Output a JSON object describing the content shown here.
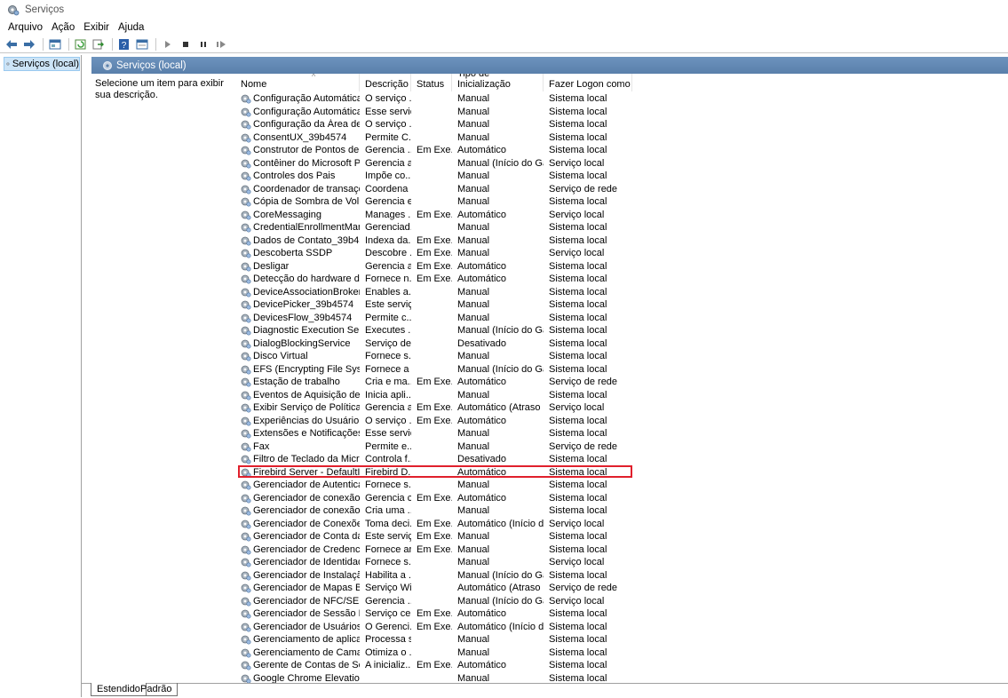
{
  "window": {
    "title": "Serviços"
  },
  "menu": [
    "Arquivo",
    "Ação",
    "Exibir",
    "Ajuda"
  ],
  "toolbar": {
    "icons": [
      "back-icon",
      "forward-icon",
      "console-tree-icon",
      "refresh-icon",
      "export-icon",
      "help-icon",
      "properties-icon",
      "play-icon",
      "stop-icon",
      "pause-icon",
      "resume-icon"
    ]
  },
  "tree": {
    "root_label": "Serviços (local)"
  },
  "header": {
    "label": "Serviços (local)"
  },
  "description": {
    "text": "Selecione um item para exibir sua descrição."
  },
  "columns": {
    "name": "Nome",
    "desc": "Descrição",
    "status": "Status",
    "start": "Tipo de Inicialização",
    "logon": "Fazer Logon como"
  },
  "services": [
    [
      "Configuração Automática d...",
      "O serviço ...",
      "",
      "Manual",
      "Sistema local"
    ],
    [
      "Configuração Automática d...",
      "Esse serviç...",
      "",
      "Manual",
      "Sistema local"
    ],
    [
      "Configuração da Área de Tr...",
      "O serviço ...",
      "",
      "Manual",
      "Sistema local"
    ],
    [
      "ConsentUX_39b4574",
      "Permite C...",
      "",
      "Manual",
      "Sistema local"
    ],
    [
      "Construtor de Pontos de Ex...",
      "Gerencia ...",
      "Em Exe...",
      "Automático",
      "Sistema local"
    ],
    [
      "Contêiner do Microsoft Pas...",
      "Gerencia a...",
      "",
      "Manual (Início do Ga...",
      "Serviço local"
    ],
    [
      "Controles dos Pais",
      "Impõe co...",
      "",
      "Manual",
      "Sistema local"
    ],
    [
      "Coordenador de transações...",
      "Coordena ...",
      "",
      "Manual",
      "Serviço de rede"
    ],
    [
      "Cópia de Sombra de Volume",
      "Gerencia e...",
      "",
      "Manual",
      "Sistema local"
    ],
    [
      "CoreMessaging",
      "Manages ...",
      "Em Exe...",
      "Automático",
      "Serviço local"
    ],
    [
      "CredentialEnrollmentMana...",
      "Gerenciad...",
      "",
      "Manual",
      "Sistema local"
    ],
    [
      "Dados de Contato_39b4574",
      "Indexa da...",
      "Em Exe...",
      "Manual",
      "Sistema local"
    ],
    [
      "Descoberta SSDP",
      "Descobre ...",
      "Em Exe...",
      "Manual",
      "Serviço local"
    ],
    [
      "Desligar",
      "Gerencia a...",
      "Em Exe...",
      "Automático",
      "Sistema local"
    ],
    [
      "Detecção do hardware do s...",
      "Fornece n...",
      "Em Exe...",
      "Automático",
      "Sistema local"
    ],
    [
      "DeviceAssociationBroker_39...",
      "Enables a...",
      "",
      "Manual",
      "Sistema local"
    ],
    [
      "DevicePicker_39b4574",
      "Este serviç...",
      "",
      "Manual",
      "Sistema local"
    ],
    [
      "DevicesFlow_39b4574",
      "Permite c...",
      "",
      "Manual",
      "Sistema local"
    ],
    [
      "Diagnostic Execution Service",
      "Executes ...",
      "",
      "Manual (Início do Ga...",
      "Sistema local"
    ],
    [
      "DialogBlockingService",
      "Serviço de...",
      "",
      "Desativado",
      "Sistema local"
    ],
    [
      "Disco Virtual",
      "Fornece s...",
      "",
      "Manual",
      "Sistema local"
    ],
    [
      "EFS (Encrypting File System)",
      "Fornece a ...",
      "",
      "Manual (Início do Ga...",
      "Sistema local"
    ],
    [
      "Estação de trabalho",
      "Cria e ma...",
      "Em Exe...",
      "Automático",
      "Serviço de rede"
    ],
    [
      "Eventos de Aquisição de Im...",
      "Inicia apli...",
      "",
      "Manual",
      "Sistema local"
    ],
    [
      "Exibir Serviço de Política",
      "Gerencia a...",
      "Em Exe...",
      "Automático (Atraso ...",
      "Serviço local"
    ],
    [
      "Experiências do Usuário Co...",
      "O serviço ...",
      "Em Exe...",
      "Automático",
      "Sistema local"
    ],
    [
      "Extensões e Notificações da...",
      "Esse serviç...",
      "",
      "Manual",
      "Sistema local"
    ],
    [
      "Fax",
      "Permite e...",
      "",
      "Manual",
      "Serviço de rede"
    ],
    [
      "Filtro de Teclado da Microsoft",
      "Controla f...",
      "",
      "Desativado",
      "Sistema local"
    ],
    [
      "Firebird Server - DefaultInst...",
      "Firebird D...",
      "",
      "Automático",
      "Sistema local"
    ],
    [
      "Gerenciador de Autenticaçã...",
      "Fornece s...",
      "",
      "Manual",
      "Sistema local"
    ],
    [
      "Gerenciador de conexão de ...",
      "Gerencia c...",
      "Em Exe...",
      "Automático",
      "Sistema local"
    ],
    [
      "Gerenciador de conexão de ...",
      "Cria uma ...",
      "",
      "Manual",
      "Sistema local"
    ],
    [
      "Gerenciador de Conexões d...",
      "Toma deci...",
      "Em Exe...",
      "Automático (Início d...",
      "Serviço local"
    ],
    [
      "Gerenciador de Conta da W...",
      "Este serviç...",
      "Em Exe...",
      "Manual",
      "Sistema local"
    ],
    [
      "Gerenciador de Credenciais",
      "Fornece ar...",
      "Em Exe...",
      "Manual",
      "Sistema local"
    ],
    [
      "Gerenciador de Identidades ...",
      "Fornece s...",
      "",
      "Manual",
      "Serviço local"
    ],
    [
      "Gerenciador de Instalação d...",
      "Habilita a ...",
      "",
      "Manual (Início do Ga...",
      "Sistema local"
    ],
    [
      "Gerenciador de Mapas Baix...",
      "Serviço Wi...",
      "",
      "Automático (Atraso ...",
      "Serviço de rede"
    ],
    [
      "Gerenciador de NFC/SE e P...",
      "Gerencia ...",
      "",
      "Manual (Início do Ga...",
      "Serviço local"
    ],
    [
      "Gerenciador de Sessão Local",
      "Serviço ce...",
      "Em Exe...",
      "Automático",
      "Sistema local"
    ],
    [
      "Gerenciador de Usuários",
      "O Gerenci...",
      "Em Exe...",
      "Automático (Início d...",
      "Sistema local"
    ],
    [
      "Gerenciamento de aplicativo",
      "Processa s...",
      "",
      "Manual",
      "Sistema local"
    ],
    [
      "Gerenciamento de Camada...",
      "Otimiza o ...",
      "",
      "Manual",
      "Sistema local"
    ],
    [
      "Gerente de Contas de Segur...",
      "A inicializ...",
      "Em Exe...",
      "Automático",
      "Sistema local"
    ],
    [
      "Google Chrome Elevation S...",
      "",
      "",
      "Manual",
      "Sistema local"
    ]
  ],
  "highlighted_service": "Firebird Server - DefaultInst...",
  "tabs": {
    "extended": "Estendido",
    "standard": "Padrão"
  },
  "colors": {
    "highlight": "#e0202c",
    "header": "#6d93bd",
    "tree_selected": "#cce4f7"
  }
}
